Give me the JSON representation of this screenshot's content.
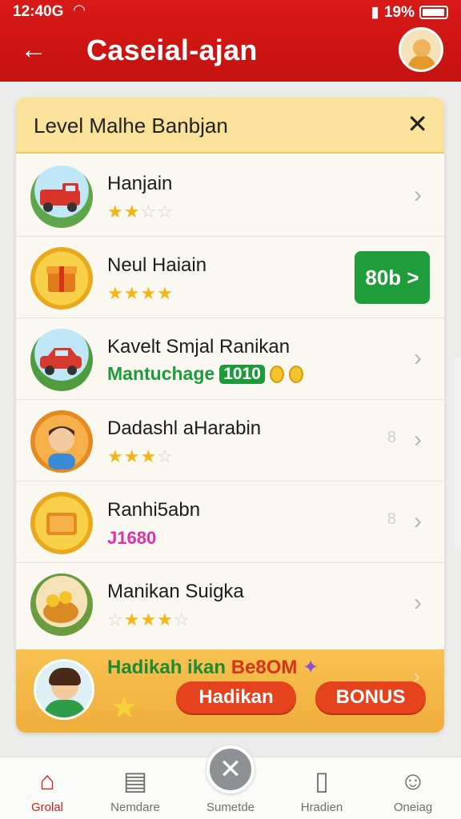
{
  "status_bar": {
    "time": "12:40G",
    "battery": "19%"
  },
  "header": {
    "title": "Caseial-ajan"
  },
  "card": {
    "title": "Level Malhe Banbjan",
    "items": [
      {
        "title": "Hanjain",
        "stars": 2,
        "max_stars": 4
      },
      {
        "title": "Neul Haiain",
        "stars": 4,
        "max_stars": 4,
        "action_label": "80b >"
      },
      {
        "title": "Kavelt Smjal Ranikan",
        "subtitle": "Mantuchage",
        "badge": "1010"
      },
      {
        "title": "Dadashl aHarabin",
        "stars": 3,
        "max_stars": 4,
        "side_number": "8"
      },
      {
        "title": "Ranhi5abn",
        "value": "J1680",
        "side_number": "8"
      },
      {
        "title": "Manikan Suigka",
        "stars": 3,
        "max_stars": 5
      }
    ]
  },
  "bonus": {
    "text_main": "Hadikah ikan",
    "text_accent": "Be8OM",
    "button_left": "Hadikan",
    "button_right": "BONUS"
  },
  "nav": [
    {
      "label": "Grolal",
      "icon": "home-icon",
      "active": true
    },
    {
      "label": "Nemdare",
      "icon": "news-icon",
      "active": false
    },
    {
      "label": "Sumetde",
      "icon": "close-circle-icon",
      "active": false
    },
    {
      "label": "Hradien",
      "icon": "phone-icon",
      "active": false
    },
    {
      "label": "Oneiag",
      "icon": "user-icon",
      "active": false
    }
  ],
  "colors": {
    "header_red": "#d71a17",
    "card_head_yellow": "#fbe29a",
    "green": "#1f9d3a",
    "orange_button": "#e4431d",
    "star": "#f4b516"
  }
}
